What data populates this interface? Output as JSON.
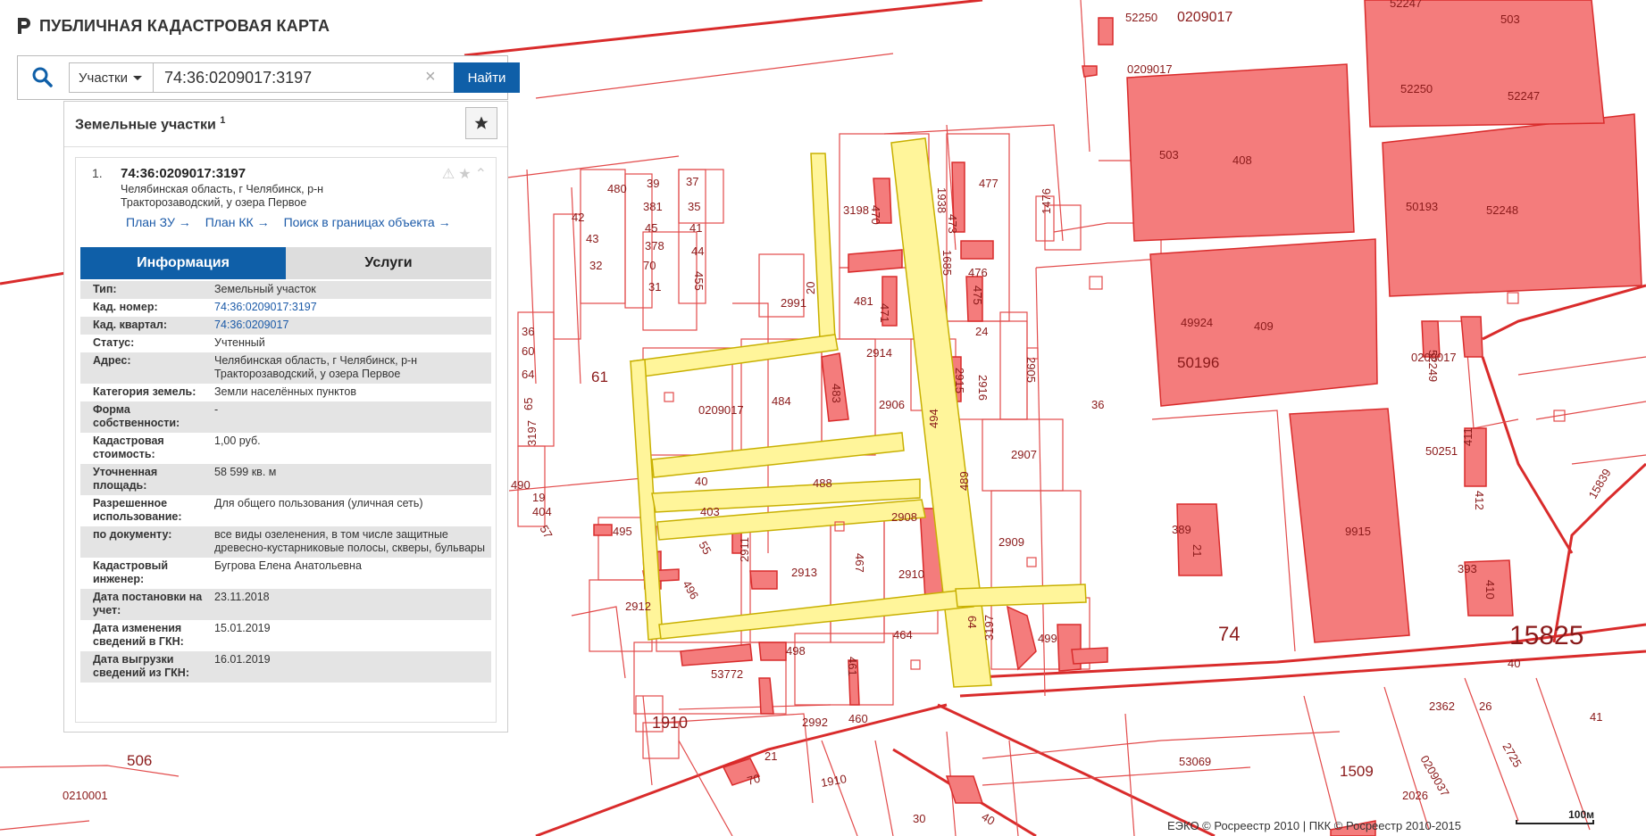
{
  "header": {
    "title": "ПУБЛИЧНАЯ КАДАСТРОВАЯ КАРТА"
  },
  "search": {
    "type_label": "Участки",
    "query": "74:36:0209017:3197",
    "find_label": "Найти"
  },
  "panel": {
    "title": "Земельные участки",
    "count": "1",
    "result": {
      "number": "1.",
      "cad_number": "74:36:0209017:3197",
      "address_short": "Челябинская область, г Челябинск, р-н Тракторозаводский, у озера Первое",
      "links": [
        "План ЗУ →",
        "План КК →",
        "Поиск в границах объекта →"
      ],
      "tabs": [
        "Информация",
        "Услуги"
      ],
      "rows": [
        {
          "label": "Тип:",
          "value": "Земельный участок"
        },
        {
          "label": "Кад. номер:",
          "value": "74:36:0209017:3197",
          "link": true
        },
        {
          "label": "Кад. квартал:",
          "value": "74:36:0209017",
          "link": true
        },
        {
          "label": "Статус:",
          "value": "Учтенный"
        },
        {
          "label": "Адрес:",
          "value": "Челябинская область, г Челябинск, р-н Тракторозаводский, у озера Первое"
        },
        {
          "label": "Категория земель:",
          "value": "Земли населённых пунктов"
        },
        {
          "label": "Форма собственности:",
          "value": "-"
        },
        {
          "label": "Кадастровая стоимость:",
          "value": "1,00 руб."
        },
        {
          "label": "Уточненная площадь:",
          "value": "58 599 кв. м"
        },
        {
          "label": "Разрешенное использование:",
          "value": "Для общего пользования (уличная сеть)"
        },
        {
          "label": "по документу:",
          "value": "все виды озеленения, в том числе защитные древесно-кустарниковые полосы, скверы, бульвары"
        },
        {
          "label": "Кадастровый инженер:",
          "value": "Бугрова Елена Анатольевна"
        },
        {
          "label": "Дата постановки на учет:",
          "value": "23.11.2018"
        },
        {
          "label": "Дата изменения сведений в ГКН:",
          "value": "15.01.2019"
        },
        {
          "label": "Дата выгрузки сведений из ГКН:",
          "value": "16.01.2019"
        }
      ]
    }
  },
  "map": {
    "labels": [
      "0209017",
      "52250",
      "0209017",
      "52247",
      "503",
      "52250",
      "52247",
      "503",
      "408",
      "50193",
      "52248",
      "49924",
      "409",
      "50196",
      "0209017",
      "52249",
      "50251",
      "411",
      "412",
      "15839",
      "9915",
      "389",
      "21",
      "393",
      "410",
      "15825",
      "74",
      "36",
      "3198",
      "470",
      "1938",
      "477",
      "473",
      "1685",
      "476",
      "475",
      "1476",
      "20",
      "481",
      "471",
      "2991",
      "24",
      "2914",
      "2905",
      "2916",
      "2915",
      "480",
      "39",
      "37",
      "42",
      "381",
      "35",
      "45",
      "41",
      "43",
      "378",
      "44",
      "32",
      "70",
      "455",
      "31",
      "36",
      "60",
      "64",
      "65",
      "61",
      "0209017",
      "484",
      "483",
      "2906",
      "2907",
      "494",
      "3197",
      "40",
      "488",
      "490",
      "19",
      "404",
      "403",
      "489",
      "495",
      "57",
      "55",
      "2911",
      "2913",
      "467",
      "2908",
      "2910",
      "2909",
      "496",
      "2912",
      "64",
      "3197",
      "499",
      "498",
      "464",
      "53772",
      "461",
      "2992",
      "460",
      "506",
      "0210001",
      "21",
      "70",
      "1910",
      "53069",
      "26",
      "2362",
      "41",
      "2725",
      "1509",
      "0209037",
      "2026",
      "30",
      "40",
      "40",
      "1910",
      "53069"
    ],
    "colors": {
      "parcel_line": "#e03a3a",
      "parcel_fill": "#f47c7c",
      "highlight": "#fff59a"
    }
  },
  "footer": {
    "credit": "ЕЭКО © Росреестр 2010 | ПКК © Росреестр 2010-2015",
    "scale": "100м"
  }
}
